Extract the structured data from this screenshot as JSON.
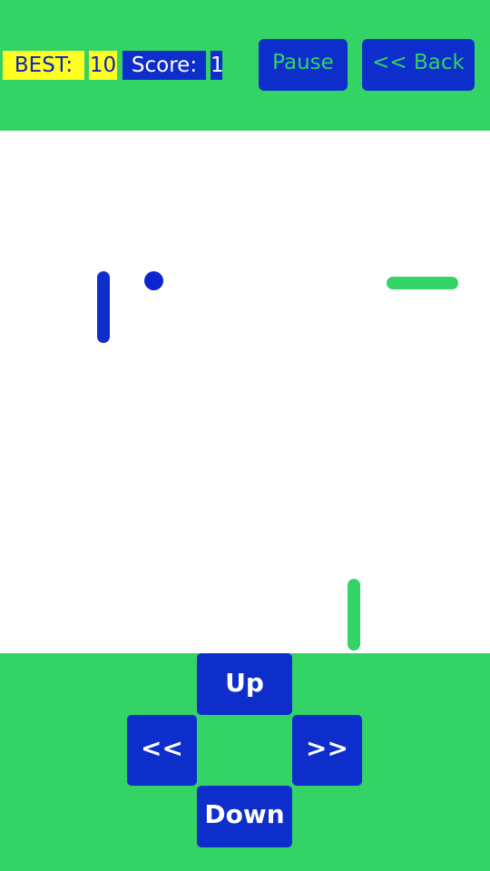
{
  "header": {
    "best_label": "BEST:",
    "best_value": "10",
    "score_label": "Score:",
    "score_value": "1",
    "pause_label": "Pause",
    "back_label": "<< Back"
  },
  "controls": {
    "up_label": "Up",
    "left_label": "<<",
    "right_label": ">>",
    "down_label": "Down"
  },
  "colors": {
    "green": "#33d366",
    "blue": "#0d2ecb",
    "yellow": "#ffff22",
    "white": "#ffffff"
  }
}
